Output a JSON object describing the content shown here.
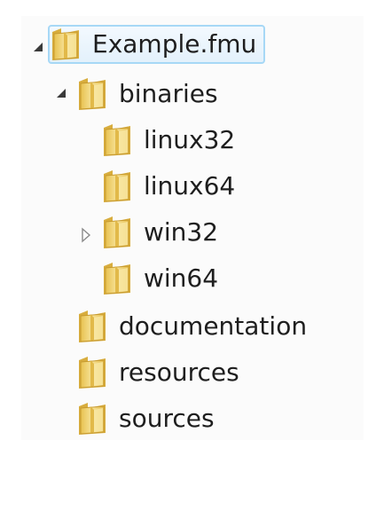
{
  "tree": {
    "root": {
      "label": "Example.fmu",
      "expanded": true
    },
    "binaries": {
      "label": "binaries",
      "expanded": true,
      "children": {
        "linux32": "linux32",
        "linux64": "linux64",
        "win32": "win32",
        "win64": "win64"
      }
    },
    "documentation": "documentation",
    "resources": "resources",
    "sources": "sources"
  },
  "icons": {
    "expanded_arrow": "expanded-arrow-icon",
    "collapsed_arrow": "collapsed-arrow-icon",
    "folder": "folder-icon"
  },
  "colors": {
    "selection_border": "#a7d8f6",
    "selection_fill": "#e3f1fb",
    "folder_body": "#f0d26c",
    "folder_shade": "#d9b245"
  }
}
